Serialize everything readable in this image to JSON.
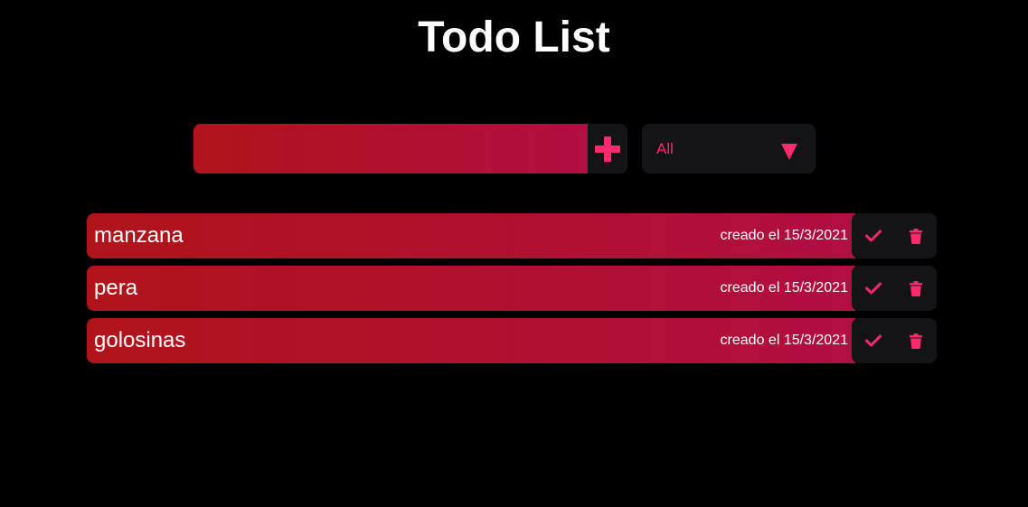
{
  "title": "Todo List",
  "form": {
    "input_value": "",
    "input_placeholder": "",
    "filter_selected": "All"
  },
  "colors": {
    "accent": "#ff2a6d",
    "gradient_start": "#b0141b",
    "gradient_end": "#b10e42",
    "panel": "#141416"
  },
  "icons": {
    "add": "plus-icon",
    "dropdown": "triangle-down-icon",
    "complete": "check-icon",
    "delete": "trash-icon"
  },
  "todos": [
    {
      "text": "manzana",
      "date": "creado el 15/3/2021"
    },
    {
      "text": "pera",
      "date": "creado el 15/3/2021"
    },
    {
      "text": "golosinas",
      "date": "creado el 15/3/2021"
    }
  ]
}
